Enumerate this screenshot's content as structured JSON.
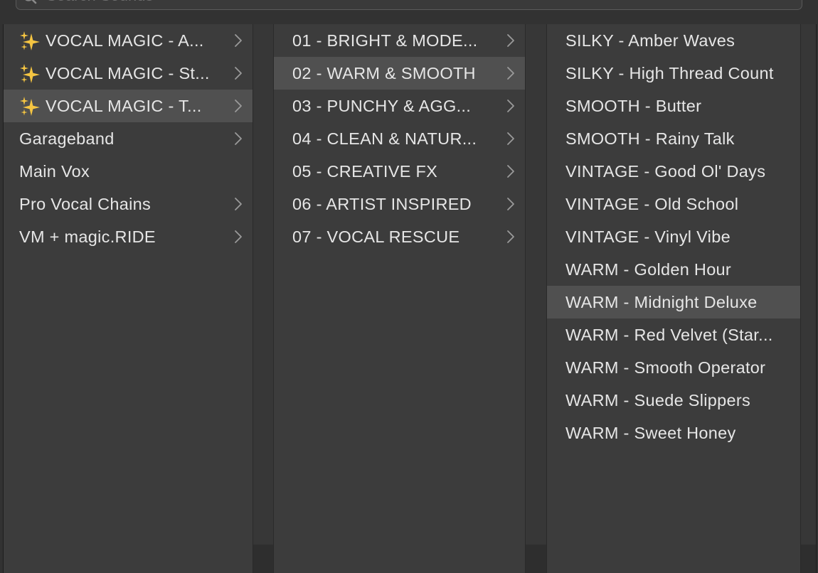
{
  "search": {
    "placeholder": "Search Sounds"
  },
  "colors": {
    "selected_row": "#505050",
    "sparkle": "#f5c542"
  },
  "column1": {
    "items": [
      {
        "label": "VOCAL MAGIC - A...",
        "icon": "sparkles-icon",
        "has_children": true,
        "selected": false
      },
      {
        "label": "VOCAL MAGIC - St...",
        "icon": "sparkles-icon",
        "has_children": true,
        "selected": false
      },
      {
        "label": "VOCAL MAGIC - T...",
        "icon": "sparkles-icon",
        "has_children": true,
        "selected": true
      },
      {
        "label": "Garageband",
        "has_children": true,
        "selected": false
      },
      {
        "label": "Main Vox",
        "has_children": false,
        "selected": false
      },
      {
        "label": "Pro Vocal Chains",
        "has_children": true,
        "selected": false
      },
      {
        "label": "VM + magic.RIDE",
        "has_children": true,
        "selected": false
      }
    ]
  },
  "column2": {
    "items": [
      {
        "label": "01 - BRIGHT & MODE...",
        "has_children": true,
        "selected": false
      },
      {
        "label": "02 - WARM & SMOOTH",
        "has_children": true,
        "selected": true
      },
      {
        "label": "03 - PUNCHY & AGG...",
        "has_children": true,
        "selected": false
      },
      {
        "label": "04 - CLEAN & NATUR...",
        "has_children": true,
        "selected": false
      },
      {
        "label": "05 - CREATIVE FX",
        "has_children": true,
        "selected": false
      },
      {
        "label": "06 - ARTIST INSPIRED",
        "has_children": true,
        "selected": false
      },
      {
        "label": "07 - VOCAL RESCUE",
        "has_children": true,
        "selected": false
      }
    ]
  },
  "column3": {
    "items": [
      {
        "label": "SILKY - Amber Waves",
        "selected": false
      },
      {
        "label": "SILKY - High Thread Count",
        "selected": false
      },
      {
        "label": "SMOOTH - Butter",
        "selected": false
      },
      {
        "label": "SMOOTH - Rainy Talk",
        "selected": false
      },
      {
        "label": "VINTAGE - Good Ol' Days",
        "selected": false
      },
      {
        "label": "VINTAGE - Old School",
        "selected": false
      },
      {
        "label": "VINTAGE - Vinyl Vibe",
        "selected": false
      },
      {
        "label": "WARM - Golden Hour",
        "selected": false
      },
      {
        "label": "WARM - Midnight Deluxe",
        "selected": true
      },
      {
        "label": "WARM - Red Velvet (Star...",
        "selected": false
      },
      {
        "label": "WARM - Smooth Operator",
        "selected": false
      },
      {
        "label": "WARM - Suede Slippers",
        "selected": false
      },
      {
        "label": "WARM - Sweet Honey",
        "selected": false
      }
    ]
  }
}
